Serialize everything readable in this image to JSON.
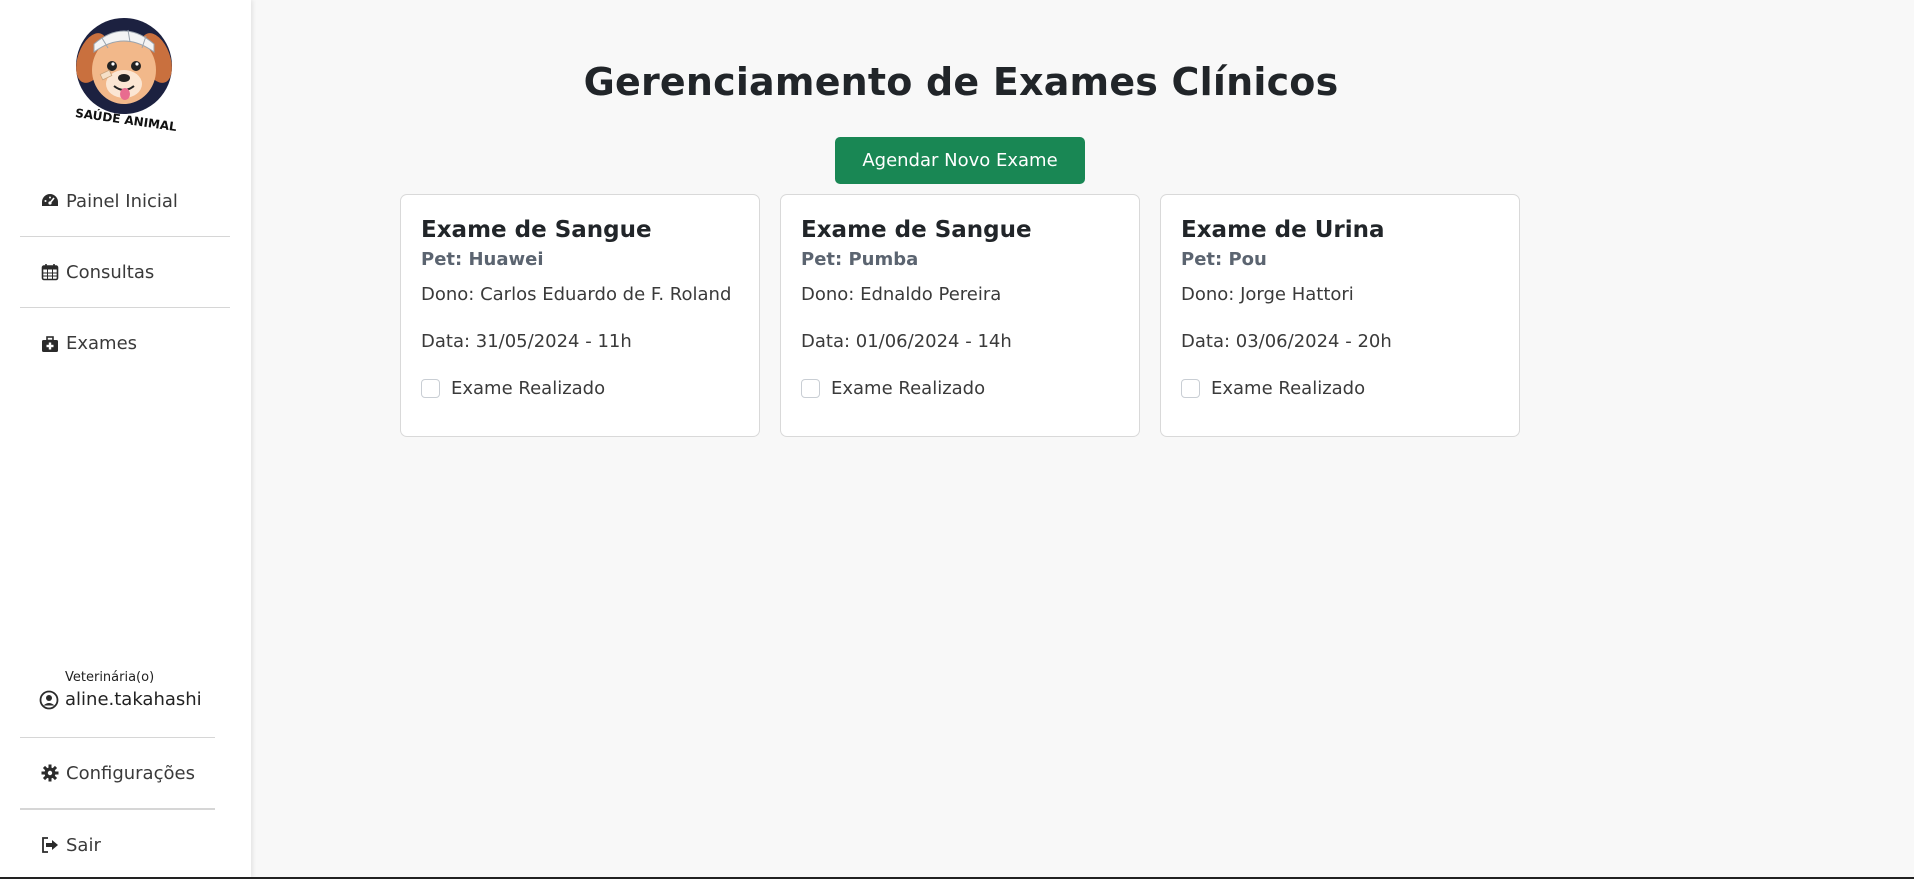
{
  "sidebar": {
    "logo_text": "SAÚDE ANIMAL",
    "items": [
      {
        "label": "Painel Inicial",
        "icon": "dashboard-icon"
      },
      {
        "label": "Consultas",
        "icon": "calendar-icon"
      },
      {
        "label": "Exames",
        "icon": "medical-kit-icon"
      }
    ],
    "user": {
      "role": "Veterinária(o)",
      "name": "aline.takahashi"
    },
    "footer_items": [
      {
        "label": "Configurações",
        "icon": "gear-icon"
      },
      {
        "label": "Sair",
        "icon": "sign-out-icon"
      }
    ]
  },
  "main": {
    "title": "Gerenciamento de Exames Clínicos",
    "new_exam_button": "Agendar Novo Exame",
    "cards": [
      {
        "title": "Exame de Sangue",
        "pet": "Pet: Huawei",
        "owner": "Dono: Carlos Eduardo de F. Roland",
        "date": "Data: 31/05/2024 - 11h",
        "check_label": "Exame Realizado"
      },
      {
        "title": "Exame de Sangue",
        "pet": "Pet: Pumba",
        "owner": "Dono: Ednaldo Pereira",
        "date": "Data: 01/06/2024 - 14h",
        "check_label": "Exame Realizado"
      },
      {
        "title": "Exame de Urina",
        "pet": "Pet: Pou",
        "owner": "Dono: Jorge Hattori",
        "date": "Data: 03/06/2024 - 20h",
        "check_label": "Exame Realizado"
      }
    ]
  },
  "colors": {
    "primary_button": "#198754",
    "background": "#f8f8f8",
    "sidebar": "#ffffff"
  }
}
